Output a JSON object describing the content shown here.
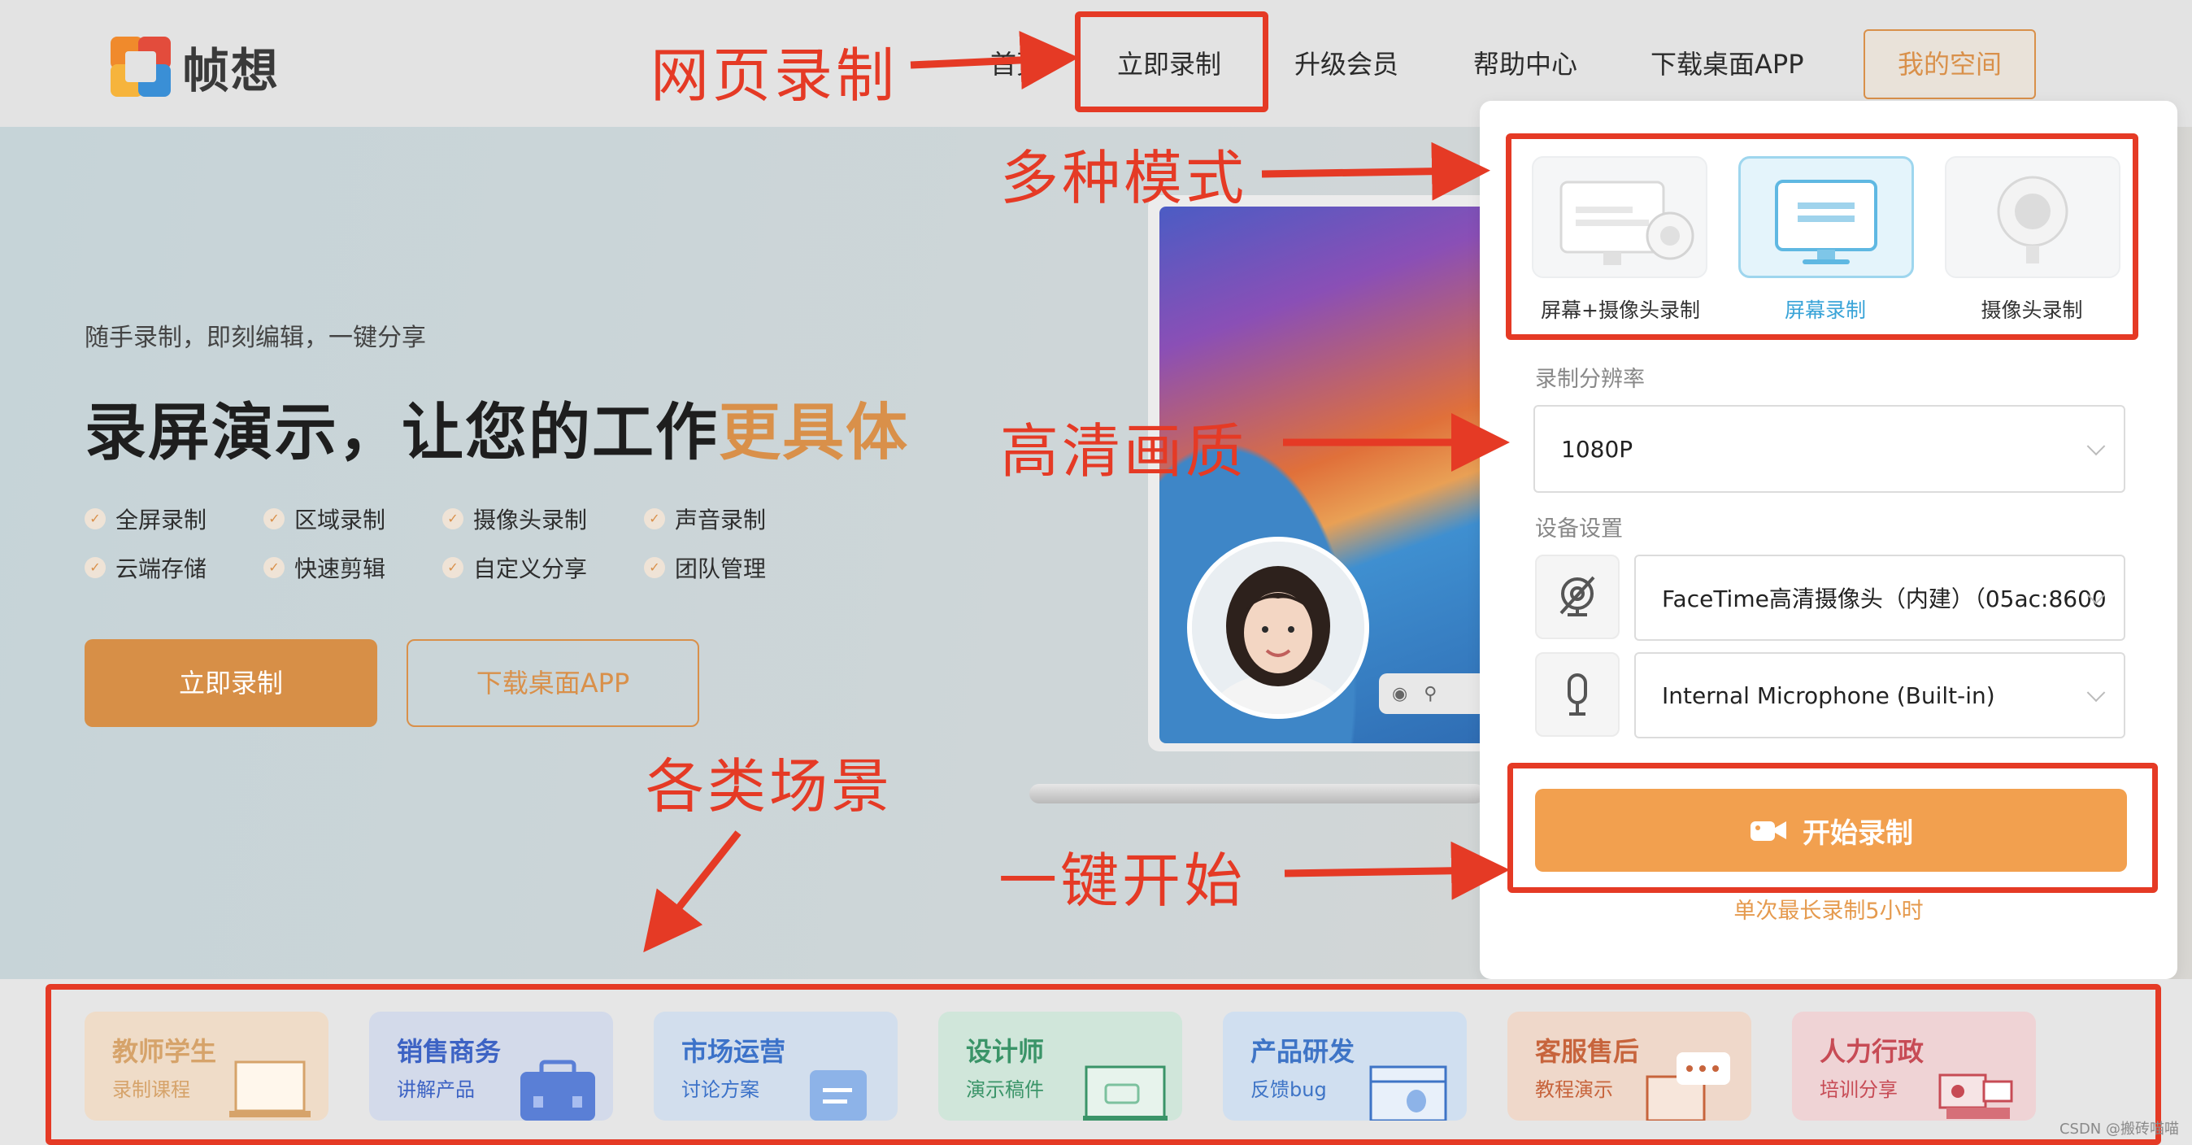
{
  "header": {
    "brand": "帧想",
    "nav": [
      "首页",
      "立即录制",
      "升级会员",
      "帮助中心",
      "下载桌面APP"
    ],
    "my_space": "我的空间"
  },
  "hero": {
    "tagline": "随手录制，即刻编辑，一键分享",
    "title_main": "录屏演示，让您的工作",
    "title_accent": "更具体",
    "features": [
      "全屏录制",
      "区域录制",
      "摄像头录制",
      "声音录制",
      "云端存储",
      "快速剪辑",
      "自定义分享",
      "团队管理"
    ],
    "btn_record": "立即录制",
    "btn_download": "下载桌面APP"
  },
  "panel": {
    "modes": [
      {
        "label": "屏幕+摄像头录制",
        "active": false
      },
      {
        "label": "屏幕录制",
        "active": true
      },
      {
        "label": "摄像头录制",
        "active": false
      }
    ],
    "resolution_label": "录制分辨率",
    "resolution_value": "1080P",
    "device_label": "设备设置",
    "camera_value": "FaceTime高清摄像头（内建）（05ac:8600",
    "mic_value": "Internal Microphone (Built-in)",
    "start_label": "开始录制",
    "limit_note": "单次最长录制5小时"
  },
  "scenarios": [
    {
      "title": "教师学生",
      "sub": "录制课程",
      "color": "#d6a36a",
      "bg": "#efdcc8"
    },
    {
      "title": "销售商务",
      "sub": "讲解产品",
      "color": "#3d63c4",
      "bg": "#d3daea"
    },
    {
      "title": "市场运营",
      "sub": "讨论方案",
      "color": "#3c72c9",
      "bg": "#d2deed"
    },
    {
      "title": "设计师",
      "sub": "演示稿件",
      "color": "#3a9468",
      "bg": "#d0e6da"
    },
    {
      "title": "产品研发",
      "sub": "反馈bug",
      "color": "#3e74c6",
      "bg": "#d0dff0"
    },
    {
      "title": "客服售后",
      "sub": "教程演示",
      "color": "#c7643c",
      "bg": "#efd8ca"
    },
    {
      "title": "人力行政",
      "sub": "培训分享",
      "color": "#c74b55",
      "bg": "#efd3d5"
    }
  ],
  "annotations": {
    "web_record": "网页录制",
    "multi_mode": "多种模式",
    "hd_quality": "高清画质",
    "scenes": "各类场景",
    "one_click": "一键开始"
  },
  "watermark": "CSDN @搬砖喵喵",
  "colors": {
    "accent": "#d9904a",
    "annotation": "#e53a25",
    "start": "#f2a04f",
    "active_mode": "#3aa4d8"
  }
}
